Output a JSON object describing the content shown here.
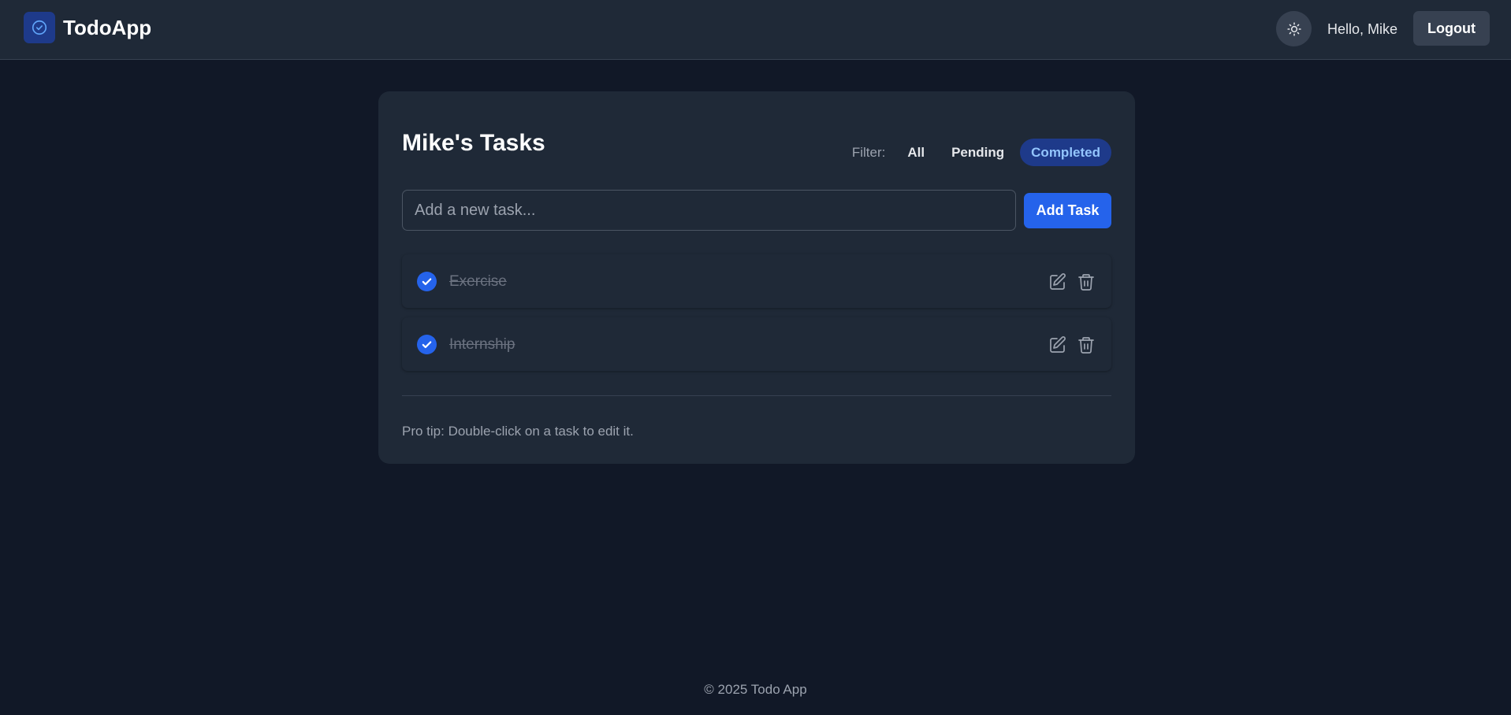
{
  "app": {
    "name": "TodoApp"
  },
  "header": {
    "theme_toggle_icon": "sun-icon",
    "greeting": "Hello, Mike",
    "logout_label": "Logout"
  },
  "main": {
    "title": "Mike's Tasks",
    "filter": {
      "label": "Filter:",
      "options": [
        "All",
        "Pending",
        "Completed"
      ],
      "active": "Completed"
    },
    "new_task": {
      "placeholder": "Add a new task...",
      "value": ""
    },
    "add_button_label": "Add Task",
    "tasks": [
      {
        "title": "Exercise",
        "completed": true
      },
      {
        "title": "Internship",
        "completed": true
      }
    ],
    "pro_tip": "Pro tip: Double-click on a task to edit it."
  },
  "footer": {
    "text": "© 2025 Todo App"
  },
  "colors": {
    "background": "#111827",
    "surface": "#1f2937",
    "accent": "#2563eb",
    "active_filter_bg": "#1e3a8a",
    "active_filter_text": "#93c5fd"
  }
}
